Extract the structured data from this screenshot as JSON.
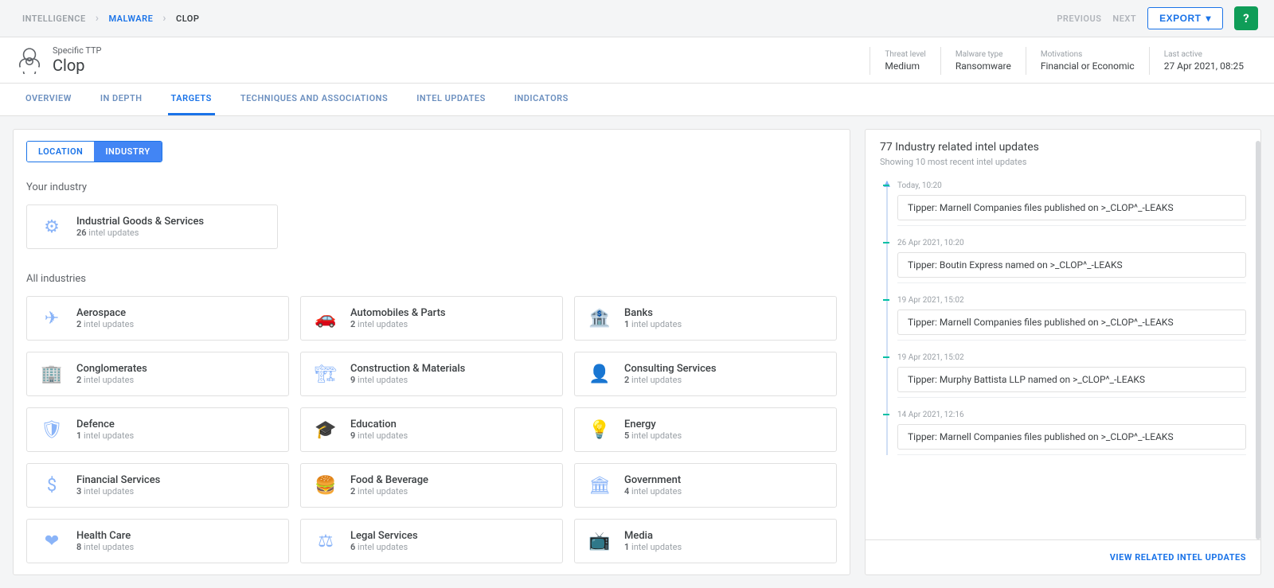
{
  "breadcrumb": {
    "level1": "Intelligence",
    "level2": "Malware",
    "level3": "Clop"
  },
  "topnav": {
    "previous": "Previous",
    "next": "Next",
    "export": "Export"
  },
  "header": {
    "overline": "Specific TTP",
    "title": "Clop"
  },
  "meta": [
    {
      "label": "Threat level",
      "value": "Medium"
    },
    {
      "label": "Malware type",
      "value": "Ransomware"
    },
    {
      "label": "Motivations",
      "value": "Financial or Economic"
    },
    {
      "label": "Last active",
      "value": "27 Apr 2021, 08:25"
    }
  ],
  "tabs": [
    "Overview",
    "In Depth",
    "Targets",
    "Techniques and Associations",
    "Intel Updates",
    "Indicators"
  ],
  "active_tab": "Targets",
  "subtabs": {
    "location": "Location",
    "industry": "Industry"
  },
  "your_industry_label": "Your industry",
  "all_industries_label": "All industries",
  "updates_suffix": "intel updates",
  "featured_industry": {
    "name": "Industrial Goods & Services",
    "count": "26",
    "icon": "gear-icon"
  },
  "industries": [
    {
      "name": "Aerospace",
      "count": "2",
      "icon": "plane-icon"
    },
    {
      "name": "Automobiles & Parts",
      "count": "2",
      "icon": "car-icon"
    },
    {
      "name": "Banks",
      "count": "1",
      "icon": "bank-icon"
    },
    {
      "name": "Conglomerates",
      "count": "2",
      "icon": "buildings-icon"
    },
    {
      "name": "Construction & Materials",
      "count": "9",
      "icon": "crane-icon"
    },
    {
      "name": "Consulting Services",
      "count": "2",
      "icon": "person-icon"
    },
    {
      "name": "Defence",
      "count": "1",
      "icon": "shield-icon"
    },
    {
      "name": "Education",
      "count": "9",
      "icon": "graduation-icon"
    },
    {
      "name": "Energy",
      "count": "5",
      "icon": "bulb-icon"
    },
    {
      "name": "Financial Services",
      "count": "3",
      "icon": "dollar-icon"
    },
    {
      "name": "Food & Beverage",
      "count": "2",
      "icon": "food-icon"
    },
    {
      "name": "Government",
      "count": "4",
      "icon": "government-icon"
    },
    {
      "name": "Health Care",
      "count": "8",
      "icon": "heart-icon"
    },
    {
      "name": "Legal Services",
      "count": "6",
      "icon": "scales-icon"
    },
    {
      "name": "Media",
      "count": "1",
      "icon": "media-icon"
    }
  ],
  "right_panel": {
    "title": "77 Industry related intel updates",
    "subtitle": "Showing 10 most recent intel updates",
    "footer_link": "View Related Intel Updates"
  },
  "updates": [
    {
      "date": "Today, 10:20",
      "text": "Tipper: Marnell Companies files published on >_CLOP^_-LEAKS"
    },
    {
      "date": "26 Apr 2021, 10:20",
      "text": "Tipper: Boutin Express named on >_CLOP^_-LEAKS"
    },
    {
      "date": "19 Apr 2021, 15:02",
      "text": "Tipper: Marnell Companies files published on >_CLOP^_-LEAKS"
    },
    {
      "date": "19 Apr 2021, 15:02",
      "text": "Tipper: Murphy Battista LLP named on >_CLOP^_-LEAKS"
    },
    {
      "date": "14 Apr 2021, 12:16",
      "text": "Tipper: Marnell Companies files published on >_CLOP^_-LEAKS"
    }
  ],
  "icons": {
    "gear-icon": "⚙",
    "plane-icon": "✈",
    "car-icon": "🚗",
    "bank-icon": "🏦",
    "buildings-icon": "🏢",
    "crane-icon": "🏗",
    "person-icon": "👤",
    "shield-icon": "🛡",
    "graduation-icon": "🎓",
    "bulb-icon": "💡",
    "dollar-icon": "$",
    "food-icon": "🍔",
    "government-icon": "🏛",
    "heart-icon": "❤",
    "scales-icon": "⚖",
    "media-icon": "📺"
  }
}
